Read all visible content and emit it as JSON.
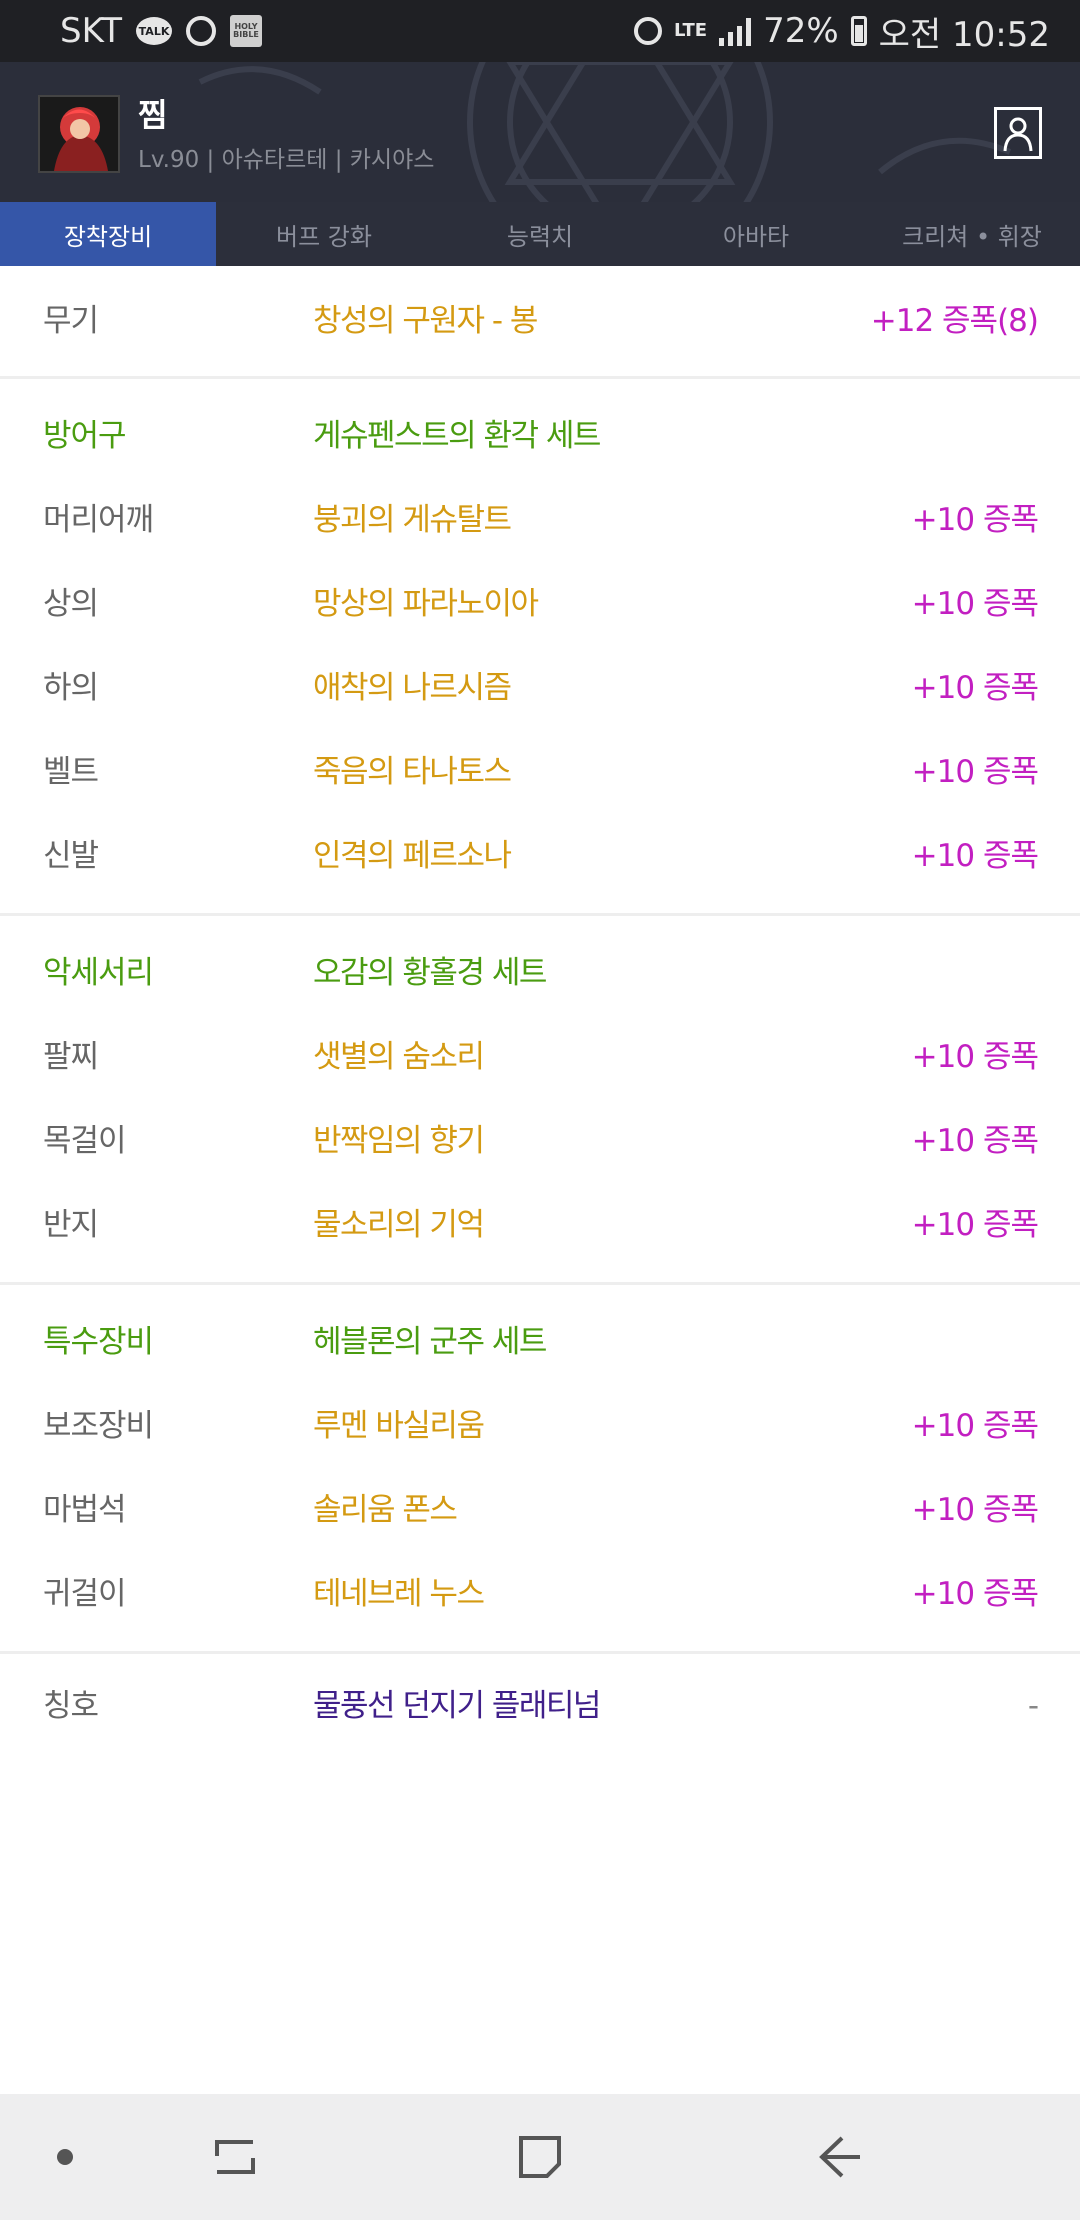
{
  "status_bar": {
    "carrier": "SKT",
    "talk_icon_text": "TALK",
    "book_icon_text": "HOLY BIBLE",
    "network": "LTE",
    "battery": "72%",
    "time": "오전 10:52"
  },
  "header": {
    "character_name": "찜",
    "character_info": "Lv.90 | 아슈타르테 | 카시야스"
  },
  "tabs": [
    {
      "label": "장착장비",
      "active": true
    },
    {
      "label": "버프 강화",
      "active": false
    },
    {
      "label": "능력치",
      "active": false
    },
    {
      "label": "아바타",
      "active": false
    },
    {
      "label": "크리쳐 • 휘장",
      "active": false
    }
  ],
  "weapon": {
    "slot": "무기",
    "item": "창성의 구원자 - 봉",
    "enhance": "+12 증폭(8)"
  },
  "armor": {
    "section": "방어구",
    "set_name": "게슈펜스트의 환각 세트",
    "items": [
      {
        "slot": "머리어깨",
        "item": "붕괴의 게슈탈트",
        "enhance": "+10 증폭"
      },
      {
        "slot": "상의",
        "item": "망상의 파라노이아",
        "enhance": "+10 증폭"
      },
      {
        "slot": "하의",
        "item": "애착의 나르시즘",
        "enhance": "+10 증폭"
      },
      {
        "slot": "벨트",
        "item": "죽음의 타나토스",
        "enhance": "+10 증폭"
      },
      {
        "slot": "신발",
        "item": "인격의 페르소나",
        "enhance": "+10 증폭"
      }
    ]
  },
  "accessory": {
    "section": "악세서리",
    "set_name": "오감의 황홀경 세트",
    "items": [
      {
        "slot": "팔찌",
        "item": "샛별의 숨소리",
        "enhance": "+10 증폭"
      },
      {
        "slot": "목걸이",
        "item": "반짝임의 향기",
        "enhance": "+10 증폭"
      },
      {
        "slot": "반지",
        "item": "물소리의 기억",
        "enhance": "+10 증폭"
      }
    ]
  },
  "special": {
    "section": "특수장비",
    "set_name": "헤블론의 군주 세트",
    "items": [
      {
        "slot": "보조장비",
        "item": "루멘 바실리움",
        "enhance": "+10 증폭"
      },
      {
        "slot": "마법석",
        "item": "솔리움 폰스",
        "enhance": "+10 증폭"
      },
      {
        "slot": "귀걸이",
        "item": "테네브레 누스",
        "enhance": "+10 증폭"
      }
    ]
  },
  "title_row": {
    "slot": "칭호",
    "item": "물풍선 던지기 플래티넘",
    "enhance": "-"
  },
  "colors": {
    "tab_active": "#3556a8",
    "item_name": "#d49a12",
    "enhance": "#c21fc1",
    "section": "#4a9c10",
    "title_item": "#40208a"
  }
}
